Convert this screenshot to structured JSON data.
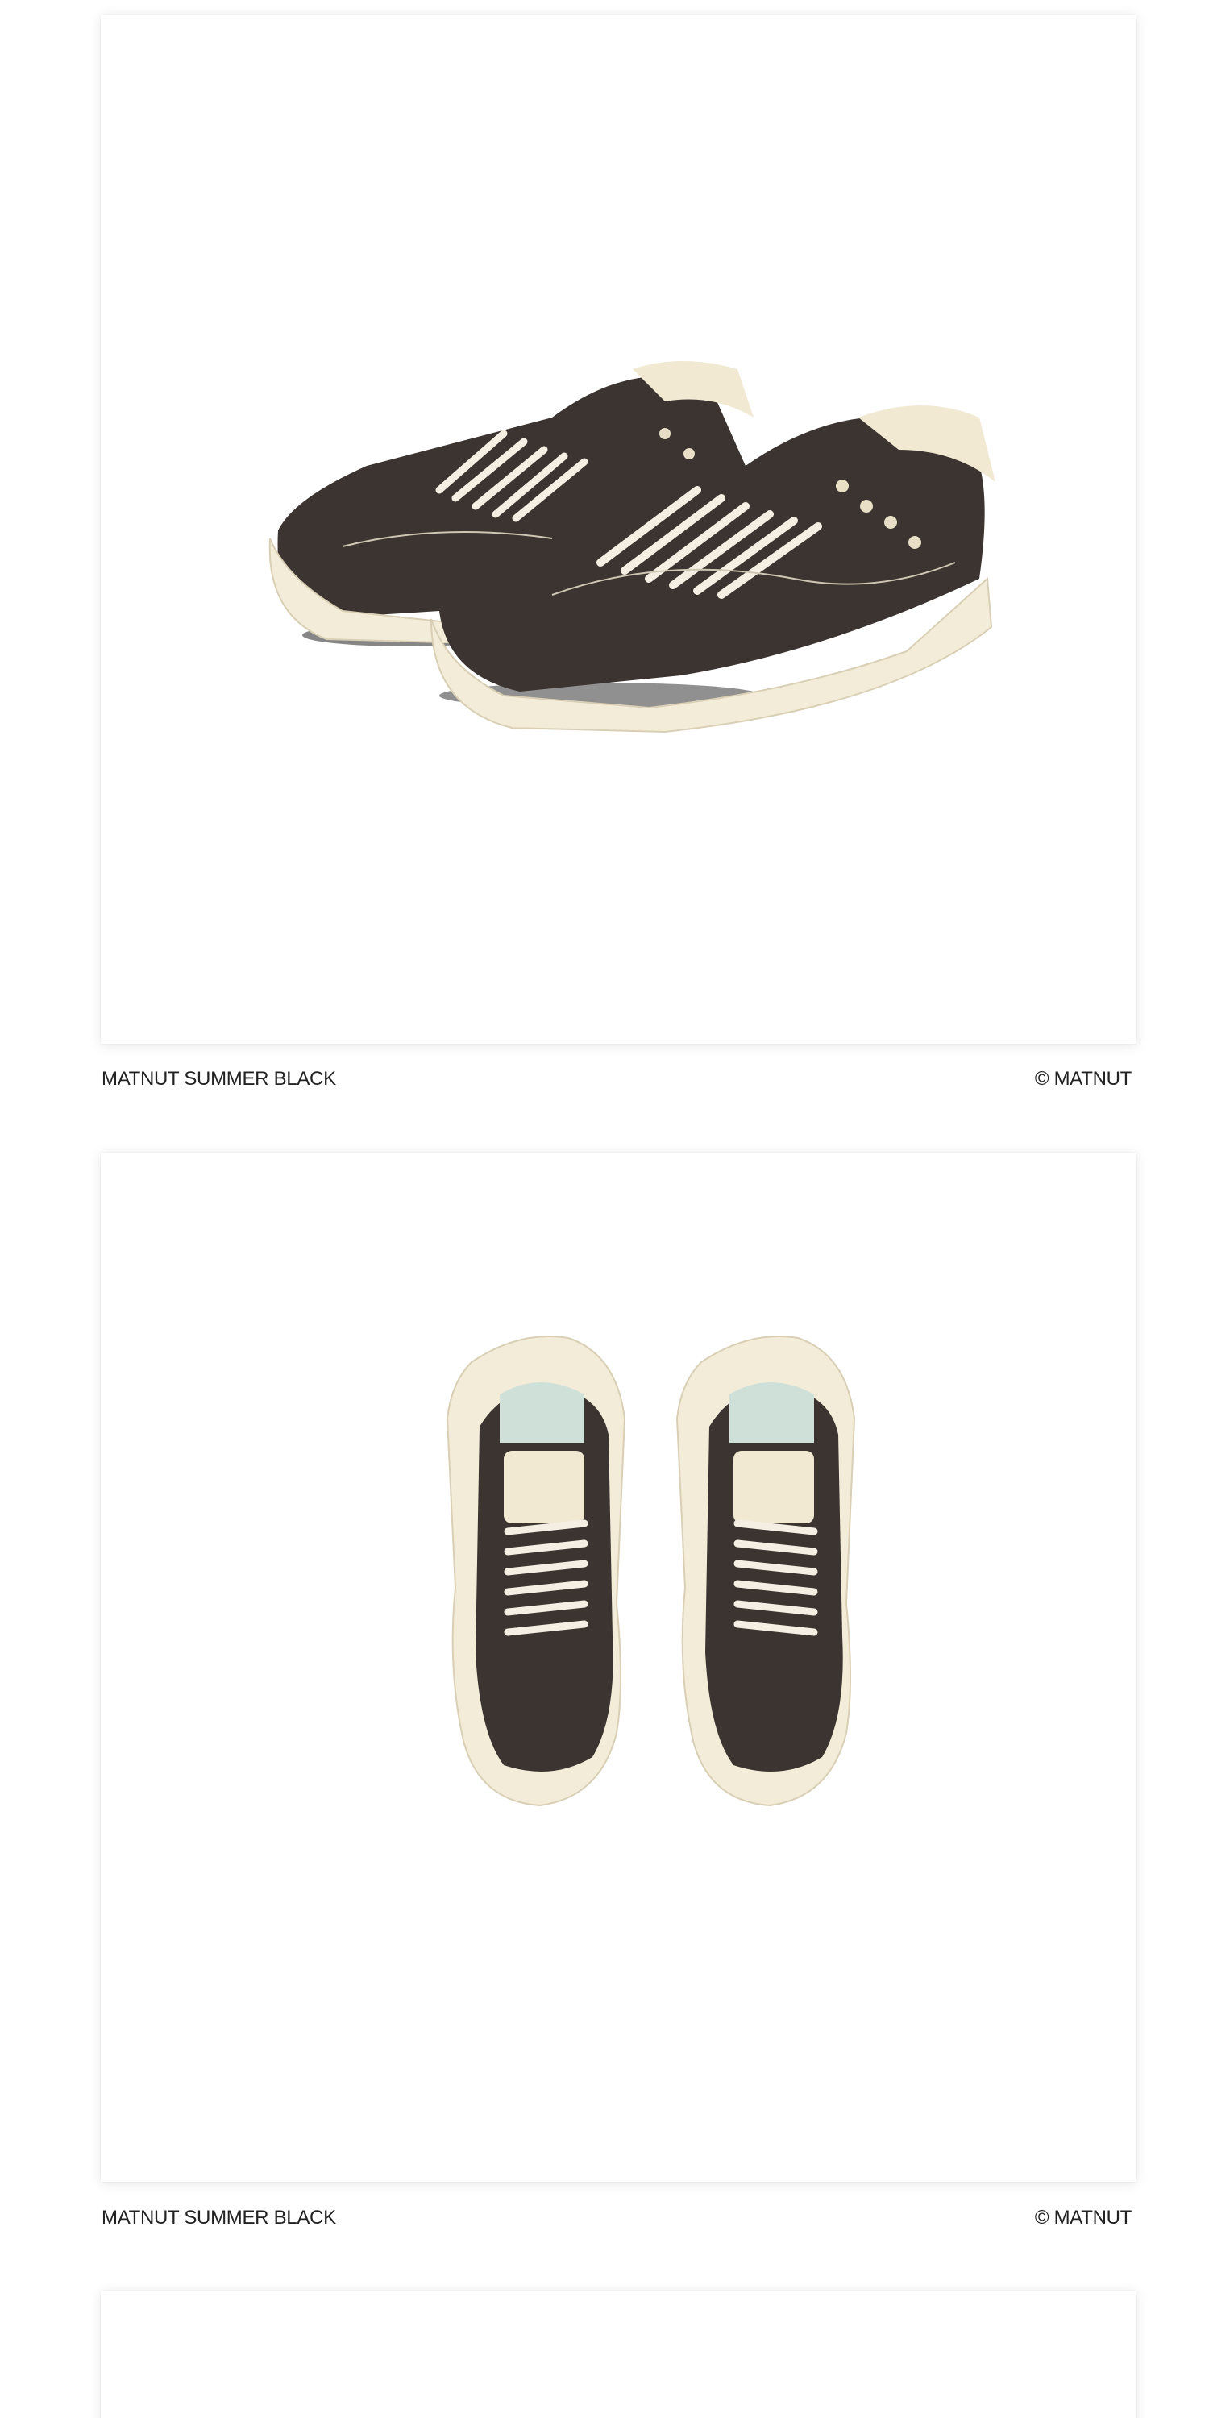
{
  "gallery": {
    "items": [
      {
        "image": "matnut-summer-black-side-view-photo",
        "caption_name": "MATNUT SUMMER BLACK",
        "credit": "© MATNUT"
      },
      {
        "image": "matnut-summer-black-top-view-photo",
        "caption_name": "MATNUT SUMMER BLACK",
        "credit": "© MATNUT"
      },
      {
        "image": "next-product-photo"
      }
    ]
  },
  "colors": {
    "upper": "#3b3430",
    "sole": "#f3ecd8",
    "collar": "#f1e9d2",
    "shadow": "#1a1a1a"
  }
}
